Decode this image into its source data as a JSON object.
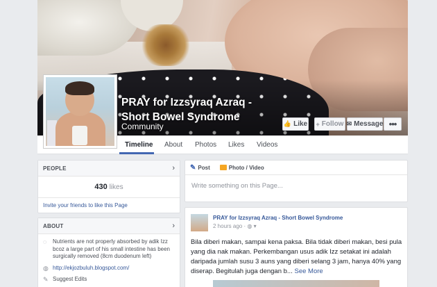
{
  "page": {
    "title": "PRAY for Izzsyraq Azraq - Short Bowel Syndrome",
    "category": "Community"
  },
  "cover_actions": {
    "like": "Like",
    "follow": "Follow",
    "message": "Message",
    "more": "•••"
  },
  "tabs": [
    {
      "label": "Timeline",
      "active": true
    },
    {
      "label": "About"
    },
    {
      "label": "Photos"
    },
    {
      "label": "Likes"
    },
    {
      "label": "Videos"
    }
  ],
  "people": {
    "header": "PEOPLE",
    "likes_count": "430",
    "likes_word": "likes",
    "invite": "Invite your friends to like this Page"
  },
  "about": {
    "header": "ABOUT",
    "description": "Nutrients are not properly absorbed by adik Izz bcoz a large part of his small intestine has been surgically removed (8cm duodenum left)",
    "website": "http://ekjozbuluh.blogspot.com/",
    "next_item": "Suggest Edits"
  },
  "composer": {
    "post_label": "Post",
    "photo_label": "Photo / Video",
    "placeholder": "Write something on this Page..."
  },
  "post": {
    "author": "PRAY for Izzsyraq Azraq - Short Bowel Syndrome",
    "time": "2 hours ago",
    "text": "Bila diberi makan, sampai kena paksa. Bila tidak diberi makan, besi pula yang dia nak makan. Perkembangan usus adik Izz setakat ini adalah daripada jumlah susu 3 auns yang diberi selang 3 jam, hanya 40% yang diserap. Begitulah juga dengan b...",
    "see_more": "See More"
  },
  "colors": {
    "brand": "#4267b2",
    "link": "#365899",
    "background": "#e9ebee"
  }
}
